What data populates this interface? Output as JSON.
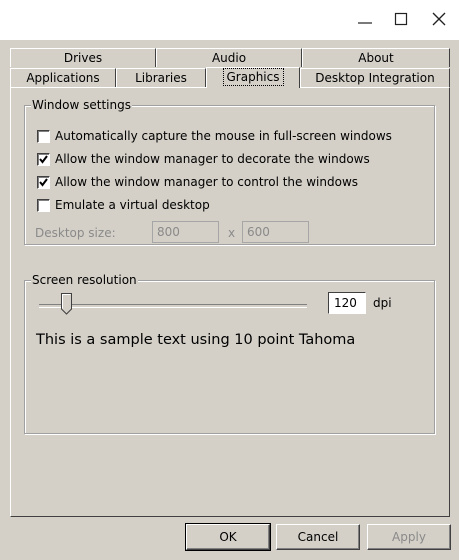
{
  "window": {
    "controls": {
      "minimize": "minimize-icon",
      "maximize": "maximize-icon",
      "close": "close-icon"
    }
  },
  "tabs": {
    "row1": [
      "Drives",
      "Audio",
      "About"
    ],
    "row2": [
      "Applications",
      "Libraries",
      "Graphics",
      "Desktop Integration"
    ],
    "selected": "Graphics"
  },
  "window_settings": {
    "title": "Window settings",
    "options": [
      {
        "label": "Automatically capture the mouse in full-screen windows",
        "checked": false
      },
      {
        "label": "Allow the window manager to decorate the windows",
        "checked": true
      },
      {
        "label": "Allow the window manager to control the windows",
        "checked": true
      },
      {
        "label": "Emulate a virtual desktop",
        "checked": false
      }
    ],
    "desktop_size_label": "Desktop size:",
    "width": "800",
    "separator": "x",
    "height": "600"
  },
  "screen_resolution": {
    "title": "Screen resolution",
    "dpi_value": "120",
    "dpi_unit": "dpi",
    "sample_text": "This is a sample text using 10 point Tahoma"
  },
  "buttons": {
    "ok": "OK",
    "cancel": "Cancel",
    "apply": "Apply"
  },
  "colors": {
    "face": "#d4d0c8",
    "titlebar": "#ffffff",
    "disabled_text": "#8a8a8a"
  }
}
